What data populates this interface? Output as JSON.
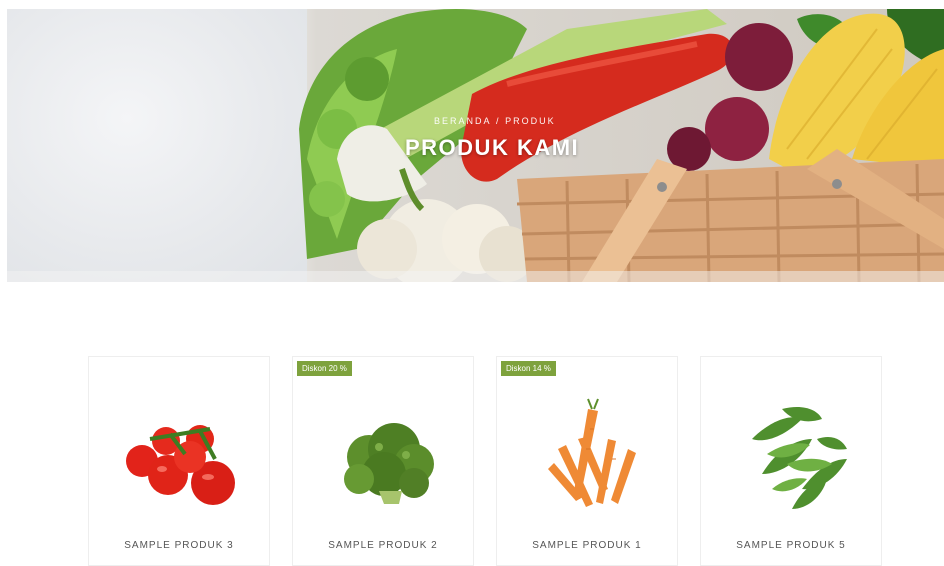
{
  "hero": {
    "breadcrumb_home": "Beranda",
    "breadcrumb_sep": "/",
    "breadcrumb_current": "Produk",
    "title": "PRODUK KAMI"
  },
  "products": [
    {
      "name": "SAMPLE PRODUK 3",
      "badge": "",
      "image": "tomato-icon"
    },
    {
      "name": "SAMPLE PRODUK 2",
      "badge": "Diskon 20 %",
      "image": "broccoli-icon"
    },
    {
      "name": "SAMPLE PRODUK 1",
      "badge": "Diskon 14 %",
      "image": "carrot-icon"
    },
    {
      "name": "SAMPLE PRODUK 5",
      "badge": "",
      "image": "peas-icon"
    }
  ],
  "colors": {
    "badge": "#7ea23d",
    "text": "#555555",
    "title": "#ffffff"
  }
}
